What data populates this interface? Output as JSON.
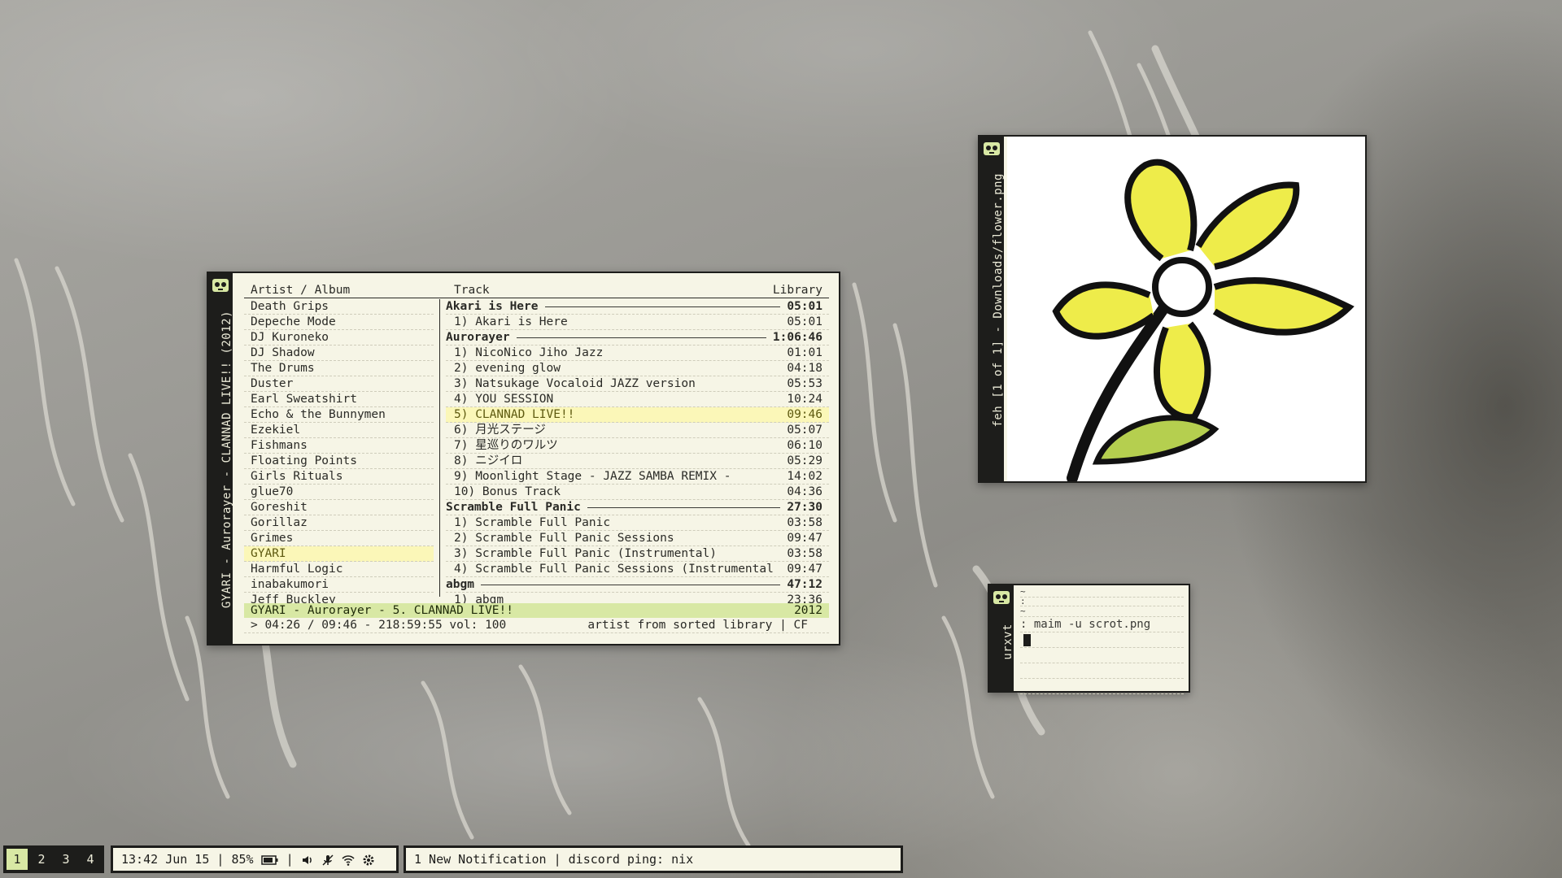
{
  "colors": {
    "accent_highlight": "#fbf7b8",
    "status_bar": "#d8e8a4",
    "window_border": "#1d1d1b",
    "window_bg": "#f6f5e6"
  },
  "player": {
    "window_title": "GYARI - Aurorayer - CLANNAD LIVE!! (2012)",
    "header_artist": "Artist / Album",
    "header_track": "Track",
    "header_library": "Library",
    "artists": [
      "Death Grips",
      "Depeche Mode",
      "DJ Kuroneko",
      "DJ Shadow",
      "The Drums",
      "Duster",
      "Earl Sweatshirt",
      "Echo & the Bunnymen",
      "Ezekiel",
      "Fishmans",
      "Floating Points",
      "Girls Rituals",
      "glue70",
      "Goreshit",
      "Gorillaz",
      "Grimes",
      "GYARI",
      "Harmful Logic",
      "inabakumori",
      "Jeff Buckley"
    ],
    "selected_artist": "GYARI",
    "tracks": [
      {
        "type": "album",
        "text": "Akari is Here",
        "duration": "05:01"
      },
      {
        "type": "track",
        "text": "1) Akari is Here",
        "duration": "05:01"
      },
      {
        "type": "album",
        "text": "Aurorayer",
        "duration": "1:06:46"
      },
      {
        "type": "track",
        "text": "1) NicoNico Jiho Jazz",
        "duration": "01:01"
      },
      {
        "type": "track",
        "text": "2) evening glow",
        "duration": "04:18"
      },
      {
        "type": "track",
        "text": "3) Natsukage Vocaloid JAZZ version",
        "duration": "05:53"
      },
      {
        "type": "track",
        "text": "4) YOU SESSION",
        "duration": "10:24"
      },
      {
        "type": "track",
        "text": "5) CLANNAD LIVE!!",
        "duration": "09:46",
        "playing": true
      },
      {
        "type": "track",
        "text": "6) 月光ステージ",
        "duration": "05:07"
      },
      {
        "type": "track",
        "text": "7) 星巡りのワルツ",
        "duration": "06:10"
      },
      {
        "type": "track",
        "text": "8) ニジイロ",
        "duration": "05:29"
      },
      {
        "type": "track",
        "text": "9) Moonlight Stage - JAZZ SAMBA REMIX -",
        "duration": "14:02"
      },
      {
        "type": "track",
        "text": "10) Bonus Track",
        "duration": "04:36"
      },
      {
        "type": "album",
        "text": "Scramble Full Panic",
        "duration": "27:30"
      },
      {
        "type": "track",
        "text": "1) Scramble Full Panic",
        "duration": "03:58"
      },
      {
        "type": "track",
        "text": "2) Scramble Full Panic Sessions",
        "duration": "09:47"
      },
      {
        "type": "track",
        "text": "3) Scramble Full Panic (Instrumental)",
        "duration": "03:58"
      },
      {
        "type": "track",
        "text": "4) Scramble Full Panic Sessions (Instrumental",
        "duration": "09:47"
      },
      {
        "type": "album",
        "text": "abgm",
        "duration": "47:12"
      },
      {
        "type": "track",
        "text": "1) abgm",
        "duration": "23:36"
      }
    ],
    "status_text": "GYARI - Aurorayer -  5. CLANNAD LIVE!!",
    "status_year": "2012",
    "cmd_left": "> 04:26 / 09:46 - 218:59:55 vol: 100",
    "cmd_right": "artist from sorted library | CF"
  },
  "feh": {
    "window_title": "feh [1 of 1] - Downloads/flower.png"
  },
  "terminal": {
    "window_title": "urxvt",
    "lines": [
      "~",
      ": ",
      "~",
      ": maim -u scrot.png"
    ]
  },
  "bar": {
    "workspaces": [
      "1",
      "2",
      "3",
      "4"
    ],
    "active_workspace": "1",
    "time": "13:42",
    "date": "Jun 15",
    "battery": "85%",
    "notification": "1 New Notification | discord ping: nix",
    "icons": [
      "volume-icon",
      "mic-muted-icon",
      "wifi-icon",
      "settings-icon"
    ]
  }
}
